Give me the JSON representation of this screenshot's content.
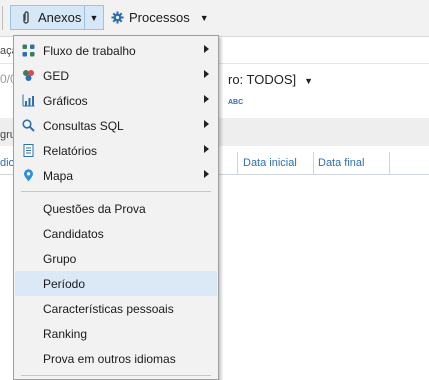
{
  "toolbar": {
    "anexos_label": "Anexos",
    "processos_label": "Processos"
  },
  "background": {
    "acao_fragment": "açã",
    "filter_prefix": "0/0",
    "filter_fragment": "ro: TODOS]",
    "abc_label": "ABC",
    "grupo_fragment": "gru",
    "col_idioma_fragment": "dio",
    "col_data_inicial": "Data inicial",
    "col_data_final": "Data final"
  },
  "menu": {
    "submenus": [
      {
        "label": "Fluxo de trabalho",
        "icon": "workflow-icon"
      },
      {
        "label": "GED",
        "icon": "ged-icon"
      },
      {
        "label": "Gráficos",
        "icon": "chart-icon"
      },
      {
        "label": "Consultas SQL",
        "icon": "search-icon"
      },
      {
        "label": "Relatórios",
        "icon": "report-icon"
      },
      {
        "label": "Mapa",
        "icon": "map-pin-icon"
      }
    ],
    "items": [
      {
        "label": "Questões da Prova"
      },
      {
        "label": "Candidatos"
      },
      {
        "label": "Grupo"
      },
      {
        "label": "Período",
        "highlighted": true
      },
      {
        "label": "Características pessoais"
      },
      {
        "label": "Ranking"
      },
      {
        "label": "Prova em outros idiomas"
      }
    ]
  },
  "colors": {
    "highlight": "#dbe8f6",
    "accent": "#2e6fad",
    "menu_bg": "#f2f2f2"
  }
}
